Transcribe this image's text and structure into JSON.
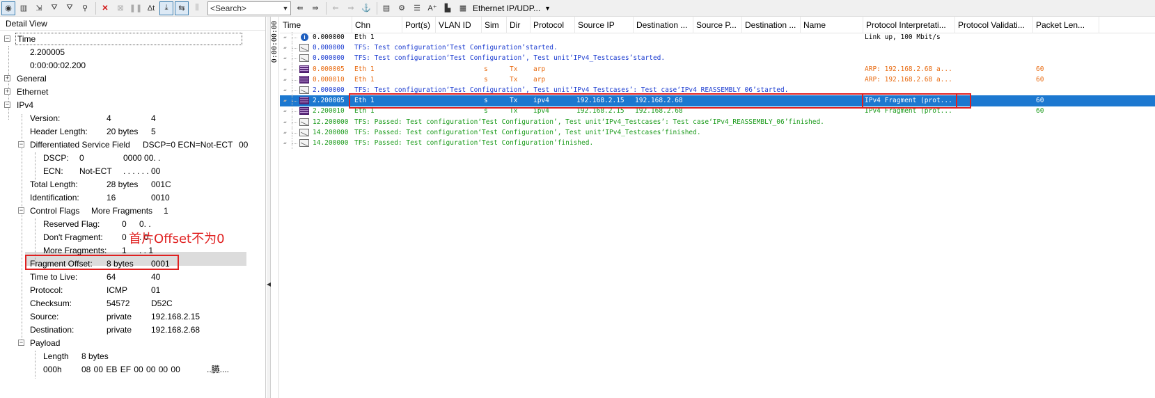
{
  "toolbar": {
    "search_placeholder": "<Search>",
    "filter_label": "Ethernet IP/UDP..."
  },
  "detail": {
    "header": "Detail View",
    "time": {
      "label": "Time",
      "v1": "2.200005",
      "v2": "0:00:00:02.200"
    },
    "general": "General",
    "ethernet": "Ethernet",
    "ipv4": "IPv4",
    "fields": {
      "version": {
        "k": "Version:",
        "v": "4",
        "h": "4"
      },
      "header_length": {
        "k": "Header Length:",
        "v": "20 bytes",
        "h": "5"
      },
      "dsf": {
        "k": "Differentiated Service Field",
        "v": "DSCP=0 ECN=Not-ECT",
        "h": "00"
      },
      "dscp": {
        "k": "DSCP:",
        "v": "0",
        "h": "0000 00. ."
      },
      "ecn": {
        "k": "ECN:",
        "v": "Not-ECT",
        "h": ". . . . . . 00"
      },
      "total_length": {
        "k": "Total Length:",
        "v": "28 bytes",
        "h": "001C"
      },
      "identification": {
        "k": "Identification:",
        "v": "16",
        "h": "0010"
      },
      "control_flags": {
        "k": "Control Flags",
        "v": "More Fragments",
        "h": "1"
      },
      "reserved_flag": {
        "k": "Reserved Flag:",
        "v": "0",
        "h": "0. ."
      },
      "dont_fragment": {
        "k": "Don't Fragment:",
        "v": "0",
        "h": ". 0 ."
      },
      "more_fragments": {
        "k": "More Fragments:",
        "v": "1",
        "h": ". . 1"
      },
      "fragment_offset": {
        "k": "Fragment Offset:",
        "v": "8 bytes",
        "h": "0001"
      },
      "ttl": {
        "k": "Time to Live:",
        "v": "64",
        "h": "40"
      },
      "protocol": {
        "k": "Protocol:",
        "v": "ICMP",
        "h": "01"
      },
      "checksum": {
        "k": "Checksum:",
        "v": "54572",
        "h": "D52C"
      },
      "source": {
        "k": "Source:",
        "v": "private",
        "h": "192.168.2.15"
      },
      "destination": {
        "k": "Destination:",
        "v": "private",
        "h": "192.168.2.68"
      }
    },
    "payload": {
      "label": "Payload",
      "length_k": "Length",
      "length_v": "8 bytes",
      "hex_offset": "000h",
      "hex_bytes": "08  00  EB  EF  00  00  00  00",
      "hex_ascii": "..臙...."
    },
    "annotation": "首片Offset不为0"
  },
  "ruler_text": "0:00:00:00",
  "columns": [
    "Time",
    "Chn",
    "Port(s)",
    "VLAN ID",
    "Sim",
    "Dir",
    "Protocol",
    "Source IP",
    "Destination ...",
    "Source P...",
    "Destination ...",
    "Name",
    "Protocol Interpretati...",
    "Protocol Validati...",
    "Packet Len..."
  ],
  "rows": [
    {
      "time": "0.000000",
      "chn": "Eth 1",
      "sim": "",
      "dir": "",
      "proto": "",
      "src": "",
      "dst": "",
      "interp": "Link up, 100 Mbit/s",
      "len": "",
      "text": "",
      "icon": "info",
      "color": "black"
    },
    {
      "time": "0.000000",
      "chn": "",
      "sim": "",
      "dir": "",
      "proto": "",
      "src": "",
      "dst": "",
      "interp": "",
      "len": "",
      "text": "TFS: Test configuration‘Test Configuration’started.",
      "icon": "env",
      "color": "blue"
    },
    {
      "time": "0.000000",
      "chn": "",
      "sim": "",
      "dir": "",
      "proto": "",
      "src": "",
      "dst": "",
      "interp": "",
      "len": "",
      "text": "TFS: Test configuration‘Test Configuration’, Test unit‘IPv4_Testcases’started.",
      "icon": "env",
      "color": "blue"
    },
    {
      "time": "0.000005",
      "chn": "Eth 1",
      "sim": "s",
      "dir": "Tx",
      "proto": "arp",
      "src": "",
      "dst": "",
      "interp": "ARP: 192.168.2.68 a...",
      "len": "60",
      "text": "",
      "icon": "frm",
      "color": "orange"
    },
    {
      "time": "0.000010",
      "chn": "Eth 1",
      "sim": "s",
      "dir": "Tx",
      "proto": "arp",
      "src": "",
      "dst": "",
      "interp": "ARP: 192.168.2.68 a...",
      "len": "60",
      "text": "",
      "icon": "frm",
      "color": "orange"
    },
    {
      "time": "2.000000",
      "chn": "",
      "sim": "",
      "dir": "",
      "proto": "",
      "src": "",
      "dst": "",
      "interp": "",
      "len": "",
      "text": "TFS: Test configuration‘Test Configuration’, Test unit‘IPv4_Testcases’: Test case‘IPv4_REASSEMBLY_06’started.",
      "icon": "env",
      "color": "blue"
    },
    {
      "time": "2.200005",
      "chn": "Eth 1",
      "sim": "s",
      "dir": "Tx",
      "proto": "ipv4",
      "src": "192.168.2.15",
      "dst": "192.168.2.68",
      "interp": "IPv4 Fragment (prot...",
      "len": "60",
      "text": "",
      "icon": "frm",
      "color": "sel"
    },
    {
      "time": "2.200010",
      "chn": "Eth 1",
      "sim": "s",
      "dir": "Tx",
      "proto": "ipv4",
      "src": "192.168.2.15",
      "dst": "192.168.2.68",
      "interp": "IPv4 Fragment (prot...",
      "len": "60",
      "text": "",
      "icon": "frm",
      "color": "green"
    },
    {
      "time": "12.200000",
      "chn": "",
      "sim": "",
      "dir": "",
      "proto": "",
      "src": "",
      "dst": "",
      "interp": "",
      "len": "",
      "text": "TFS: Passed: Test configuration‘Test Configuration’, Test unit‘IPv4_Testcases’: Test case‘IPv4_REASSEMBLY_06’finished.",
      "icon": "env",
      "color": "green"
    },
    {
      "time": "14.200000",
      "chn": "",
      "sim": "",
      "dir": "",
      "proto": "",
      "src": "",
      "dst": "",
      "interp": "",
      "len": "",
      "text": "TFS: Passed: Test configuration‘Test Configuration’, Test unit‘IPv4_Testcases’finished.",
      "icon": "env",
      "color": "green"
    },
    {
      "time": "14.200000",
      "chn": "",
      "sim": "",
      "dir": "",
      "proto": "",
      "src": "",
      "dst": "",
      "interp": "",
      "len": "",
      "text": "TFS: Passed: Test configuration‘Test Configuration’finished.",
      "icon": "env",
      "color": "green"
    }
  ]
}
